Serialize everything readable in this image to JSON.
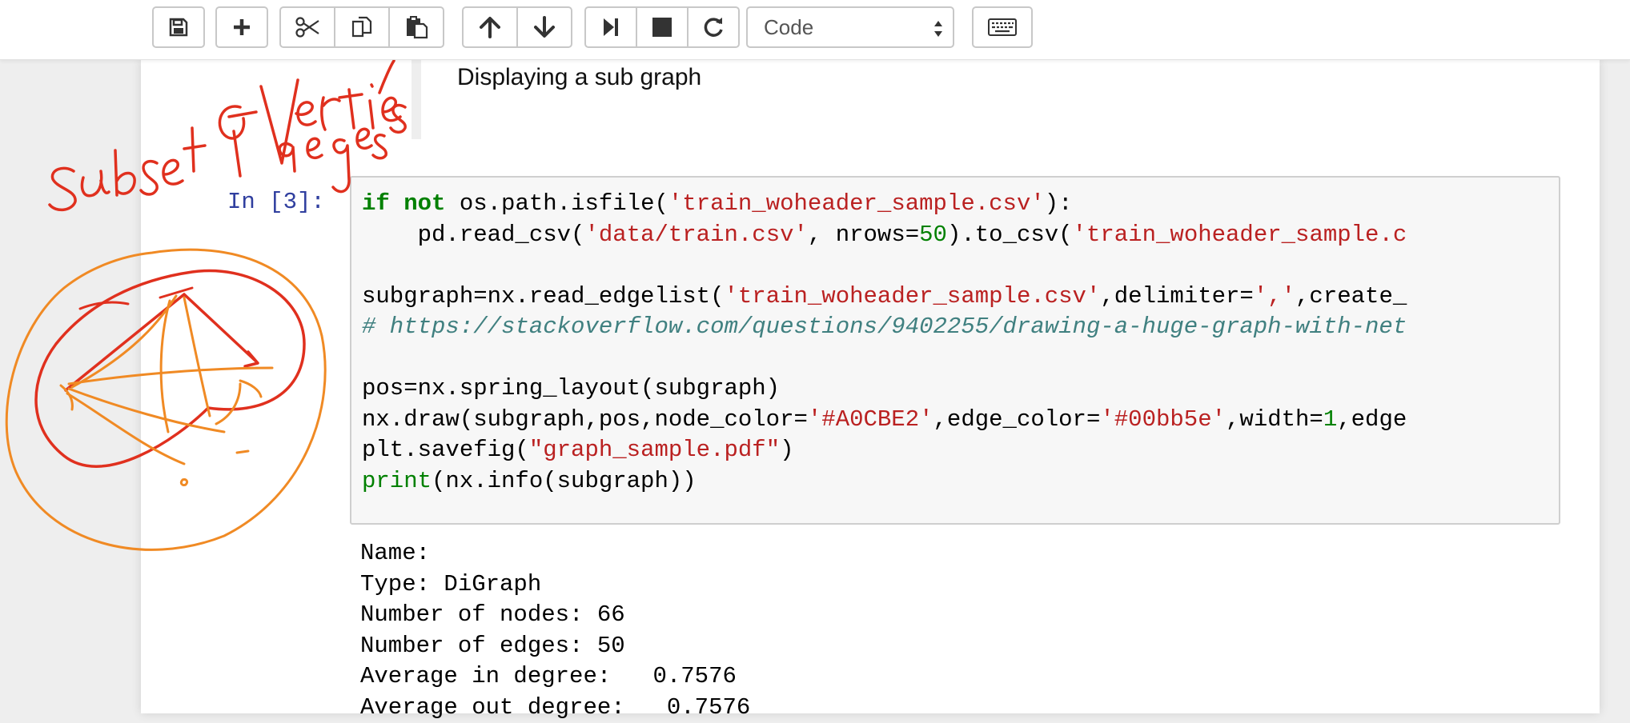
{
  "toolbar": {
    "buttons": [
      {
        "name": "save-button",
        "icon": "save-icon"
      },
      {
        "name": "insert-cell-button",
        "icon": "plus-icon"
      },
      {
        "name": "cut-button",
        "icon": "scissors-icon"
      },
      {
        "name": "copy-button",
        "icon": "copy-icon"
      },
      {
        "name": "paste-button",
        "icon": "paste-icon"
      },
      {
        "name": "move-up-button",
        "icon": "arrow-up-icon"
      },
      {
        "name": "move-down-button",
        "icon": "arrow-down-icon"
      },
      {
        "name": "run-button",
        "icon": "step-forward-icon"
      },
      {
        "name": "interrupt-button",
        "icon": "stop-icon"
      },
      {
        "name": "restart-button",
        "icon": "refresh-icon"
      },
      {
        "name": "command-palette-button",
        "icon": "keyboard-icon"
      }
    ],
    "cell_type": "Code"
  },
  "markdown_cell": {
    "text": "Displaying a sub graph"
  },
  "code_cell": {
    "prompt": "In [3]:",
    "lines": [
      "if not os.path.isfile('train_woheader_sample.csv'):",
      "    pd.read_csv('data/train.csv', nrows=50).to_csv('train_woheader_sample.c",
      "",
      "subgraph=nx.read_edgelist('train_woheader_sample.csv',delimiter=',',create_",
      "# https://stackoverflow.com/questions/9402255/drawing-a-huge-graph-with-net",
      "",
      "pos=nx.spring_layout(subgraph)",
      "nx.draw(subgraph,pos,node_color='#A0CBE2',edge_color='#00bb5e',width=1,edge",
      "plt.savefig(\"graph_sample.pdf\")",
      "print(nx.info(subgraph))"
    ]
  },
  "output": {
    "lines": [
      "Name:",
      "Type: DiGraph",
      "Number of nodes: 66",
      "Number of edges: 50",
      "Average in degree:   0.7576",
      "Average out degree:   0.7576"
    ]
  },
  "annotations": {
    "handwriting": [
      "subset",
      "of",
      "vertices",
      "edges"
    ],
    "colors": {
      "red": "#e0301e",
      "orange": "#f08a24"
    }
  },
  "colors": {
    "keyword": "#008000",
    "string": "#ba2121",
    "comment": "#408080",
    "prompt": "#303f9f",
    "code_bg": "#f7f7f7"
  }
}
